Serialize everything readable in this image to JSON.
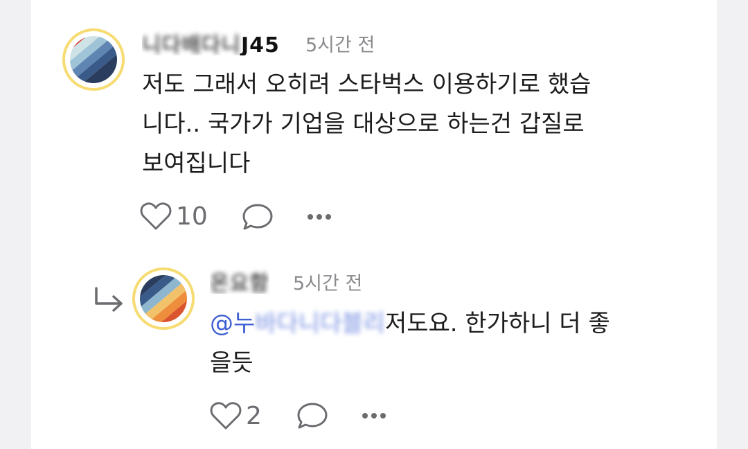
{
  "comment": {
    "username_blurred": "니다배다니 ",
    "username_visible": "J45",
    "time": "5시간 전",
    "text_lines": [
      "저도 그래서 오히려 스타벅스 이용하기로 했습",
      "니다.. 국가가 기업을 대상으로 하는건 갑질로",
      "보여집니다"
    ],
    "like_count": "10"
  },
  "reply": {
    "username_blurred": "온요함",
    "time": "5시간 전",
    "mention_prefix": "@누",
    "mention_blurred": " 바다니다블리 ",
    "text_after_mention": "저도요. 한가하니 더 좋",
    "text_line2": "을듯",
    "like_count": "2"
  },
  "icons": {
    "like": "heart-outline-icon",
    "comment": "speech-bubble-icon",
    "more": "ellipsis-icon",
    "reply": "reply-arrow-icon"
  },
  "colors": {
    "avatar_ring": "#f6dc73",
    "mention": "#3d5fd1",
    "meta_gray": "#8a8a8e"
  }
}
